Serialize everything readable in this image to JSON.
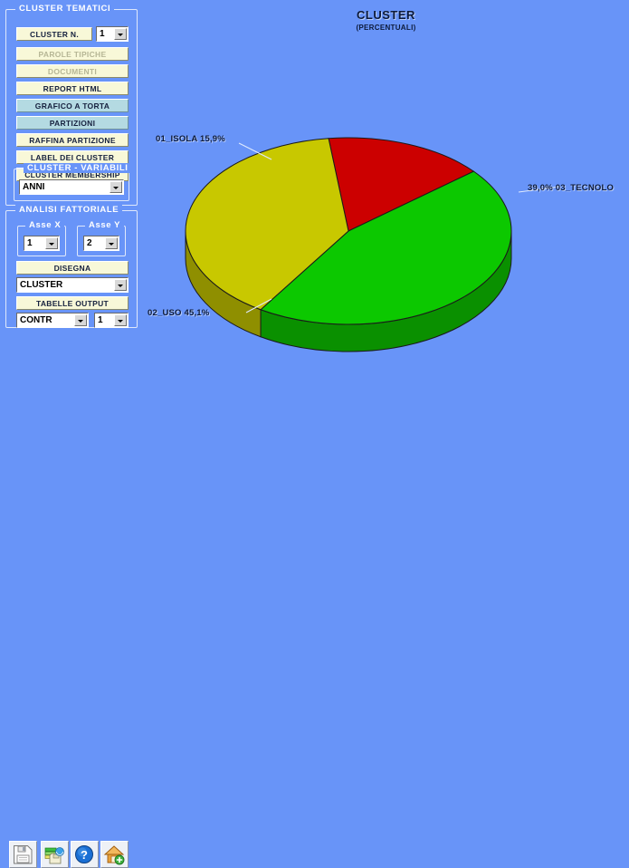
{
  "app": {
    "background_color": "#6894f8"
  },
  "panels": {
    "cluster_tematici": {
      "legend": "CLUSTER TEMATICI",
      "buttons": [
        {
          "name": "cluster-n",
          "label": "CLUSTER N.",
          "state": "normal"
        },
        {
          "name": "parole-tipiche",
          "label": "PAROLE TIPICHE",
          "state": "disabled"
        },
        {
          "name": "documenti",
          "label": "DOCUMENTI",
          "state": "disabled"
        },
        {
          "name": "report-html",
          "label": "REPORT HTML",
          "state": "normal"
        },
        {
          "name": "grafico-a-torta",
          "label": "GRAFICO A TORTA",
          "state": "active"
        },
        {
          "name": "partizioni",
          "label": "PARTIZIONI",
          "state": "active"
        },
        {
          "name": "raffina-partizione",
          "label": "RAFFINA PARTIZIONE",
          "state": "normal"
        },
        {
          "name": "label-dei-cluster",
          "label": "LABEL DEI CLUSTER",
          "state": "normal"
        },
        {
          "name": "cluster-membership",
          "label": "CLUSTER MEMBERSHIP",
          "state": "normal"
        }
      ],
      "cluster_n_select": {
        "value": "1"
      },
      "cluster_variabili": {
        "legend": "CLUSTER - VARIABILI",
        "select": {
          "value": "ANNI"
        }
      }
    },
    "analisi_fattoriale": {
      "legend": "ANALISI FATTORIALE",
      "asse_x": {
        "legend": "Asse X",
        "value": "1"
      },
      "asse_y": {
        "legend": "Asse Y",
        "value": "2"
      },
      "disegna_button": "DISEGNA",
      "disegna_select": {
        "value": "CLUSTER"
      },
      "tabelle_output_button": "TABELLE OUTPUT",
      "tabelle_select": {
        "value": "CONTR"
      },
      "tabelle_num_select": {
        "value": "1"
      }
    }
  },
  "toolbar": {
    "buttons": [
      {
        "name": "save-icon",
        "label": "save-icon"
      },
      {
        "name": "export-icon",
        "label": "export-icon"
      },
      {
        "name": "help-icon",
        "label": "help-icon"
      },
      {
        "name": "home-icon",
        "label": "home-icon"
      }
    ]
  },
  "chart_data": {
    "type": "pie",
    "title": "CLUSTER",
    "subtitle": "(PERCENTUALI)",
    "three_d": true,
    "labels": [
      "01_ISOLA",
      "02_USO",
      "03_TECNOLO"
    ],
    "values": [
      15.9,
      45.1,
      39.0
    ],
    "value_labels": [
      "15,9%",
      "45,1%",
      "39,0%"
    ],
    "display_labels": [
      "01_ISOLA  15,9%",
      "02_USO  45,1%",
      "39,0%  03_TECNOLO"
    ],
    "colors": [
      "#cc0000",
      "#0cc800",
      "#c8c800"
    ],
    "side_colors": [
      "#8f0000",
      "#0a9000",
      "#8f8f00"
    ],
    "legend": "none",
    "grid": false,
    "xlabel": "",
    "ylabel": ""
  }
}
